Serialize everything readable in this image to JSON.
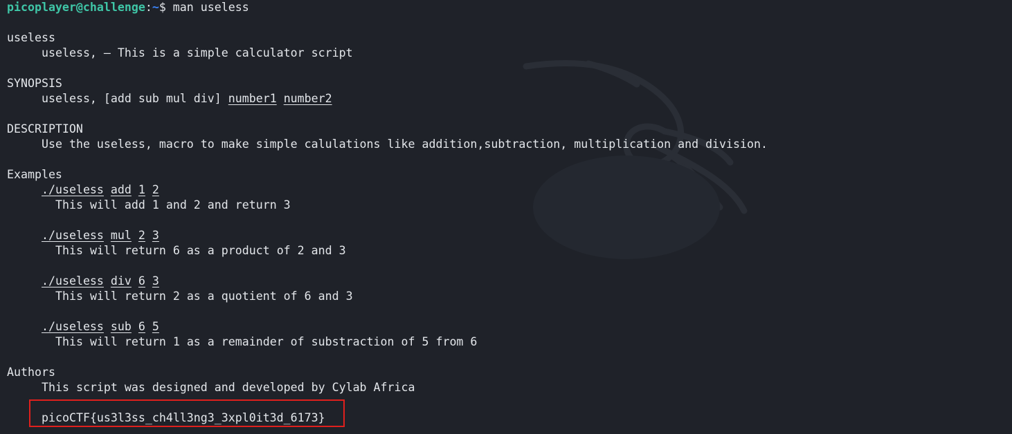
{
  "prompt": {
    "user_host": "picoplayer@challenge",
    "separator": ":",
    "path": "~",
    "symbol": "$ ",
    "command": "man useless"
  },
  "man_page": {
    "name_header": "useless",
    "name_desc": "useless, — This is a simple calculator script",
    "synopsis_header": "SYNOPSIS",
    "synopsis_cmd": "useless, [add sub mul div] ",
    "synopsis_arg1": "number1",
    "synopsis_arg2": "number2",
    "description_header": "DESCRIPTION",
    "description_text": "Use the useless, macro to make simple calulations like addition,subtraction, multiplication and division.",
    "examples_header": "Examples",
    "examples": [
      {
        "cmd": "./useless",
        "op": "add",
        "a": "1",
        "b": "2",
        "desc": "This will add 1 and 2 and return 3"
      },
      {
        "cmd": "./useless",
        "op": "mul",
        "a": "2",
        "b": "3",
        "desc": "This will return 6 as a product of 2 and 3"
      },
      {
        "cmd": "./useless",
        "op": "div",
        "a": "6",
        "b": "3",
        "desc": "This will return 2 as a quotient of 6 and 3"
      },
      {
        "cmd": "./useless",
        "op": "sub",
        "a": "6",
        "b": "5",
        "desc": "This will return 1 as a remainder of substraction of 5 from 6"
      }
    ],
    "authors_header": "Authors",
    "authors_text": "This script was designed and developed by Cylab Africa",
    "flag": "picoCTF{us3l3ss_ch4ll3ng3_3xpl0it3d_6173}"
  },
  "colors": {
    "background": "#1f2229",
    "prompt_user": "#3fc6a7",
    "prompt_path": "#3b82f6",
    "highlight_box": "#e0201d"
  }
}
